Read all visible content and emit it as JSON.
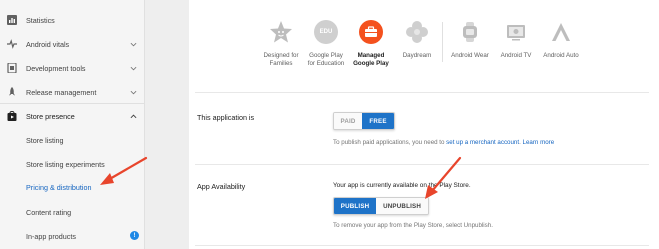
{
  "sidebar": {
    "items": [
      {
        "label": "Statistics",
        "icon": "bar-chart-icon"
      },
      {
        "label": "Android vitals",
        "icon": "pulse-icon"
      },
      {
        "label": "Development tools",
        "icon": "tools-icon"
      },
      {
        "label": "Release management",
        "icon": "rocket-icon"
      },
      {
        "label": "Store presence",
        "icon": "store-icon"
      }
    ],
    "subitems": [
      {
        "label": "Store listing"
      },
      {
        "label": "Store listing experiments"
      },
      {
        "label": "Pricing & distribution",
        "active": true
      },
      {
        "label": "Content rating"
      },
      {
        "label": "In-app products",
        "badge": "!"
      }
    ]
  },
  "categories": [
    {
      "label_1": "Designed for",
      "label_2": "Families",
      "icon": "star-face-icon"
    },
    {
      "label_1": "Google Play",
      "label_2": "for Education",
      "icon": "edu-icon",
      "badge_text": "EDU"
    },
    {
      "label_1": "Managed",
      "label_2": "Google Play",
      "icon": "briefcase-icon",
      "selected": true
    },
    {
      "label_1": "Daydream",
      "label_2": "",
      "icon": "daydream-icon"
    },
    {
      "label_1": "Android Wear",
      "label_2": "",
      "icon": "watch-icon"
    },
    {
      "label_1": "Android TV",
      "label_2": "",
      "icon": "tv-icon"
    },
    {
      "label_1": "Android Auto",
      "label_2": "",
      "icon": "auto-icon"
    }
  ],
  "pricing": {
    "label": "This application is",
    "paid": "PAID",
    "free": "FREE",
    "hint_prefix": "To publish paid applications, you need to ",
    "hint_link1": "set up a merchant account",
    "hint_mid": ". ",
    "hint_link2": "Learn more"
  },
  "availability": {
    "label": "App Availability",
    "status": "Your app is currently available on the Play Store.",
    "publish": "PUBLISH",
    "unpublish": "UNPUBLISH",
    "hint": "To remove your app from the Play Store, select Unpublish."
  },
  "colors": {
    "accent": "#1e73c8",
    "arrow": "#e8452c",
    "managed_icon": "#f4511e"
  }
}
